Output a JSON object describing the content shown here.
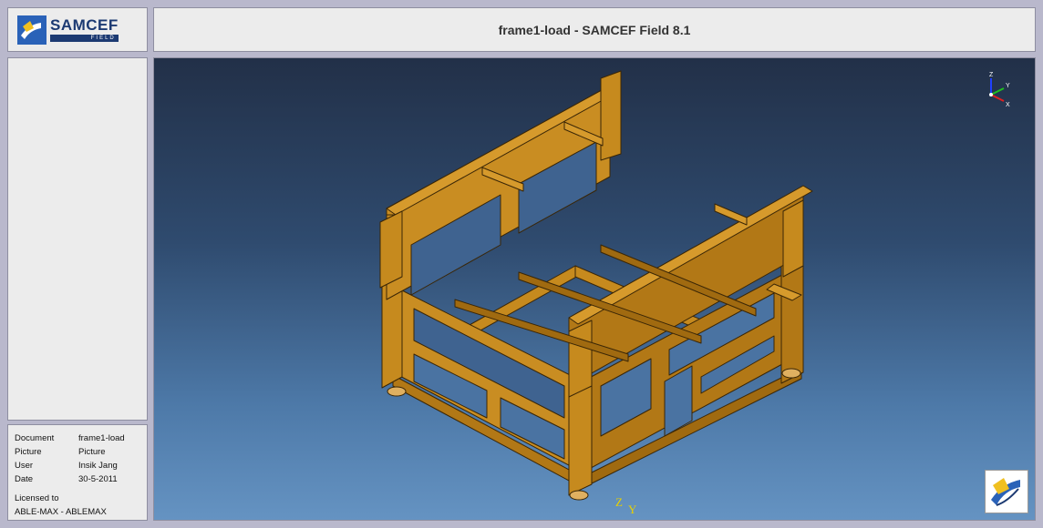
{
  "app": {
    "brand": "SAMCEF",
    "brand_sub": "FIELD",
    "window_title": "frame1-load - SAMCEF Field 8.1"
  },
  "info": {
    "rows": [
      {
        "key": "Document",
        "value": "frame1-load"
      },
      {
        "key": "Picture",
        "value": "Picture"
      },
      {
        "key": "User",
        "value": "Insik Jang"
      },
      {
        "key": "Date",
        "value": "30-5-2011"
      }
    ],
    "licensed_label": "Licensed to",
    "licensee": "ABLE-MAX - ABLEMAX"
  },
  "viewport": {
    "triad": {
      "x": "Y",
      "y": "X",
      "z": "Z"
    },
    "origin_axes": {
      "z": "Z",
      "y": "Y"
    },
    "model_color": "#c68a1e",
    "model_edge_color": "#3a2606",
    "background_top": "#223048",
    "background_bottom": "#6593c2",
    "icons": [
      "axis-triad-icon",
      "samcef-corner-logo-icon"
    ]
  }
}
